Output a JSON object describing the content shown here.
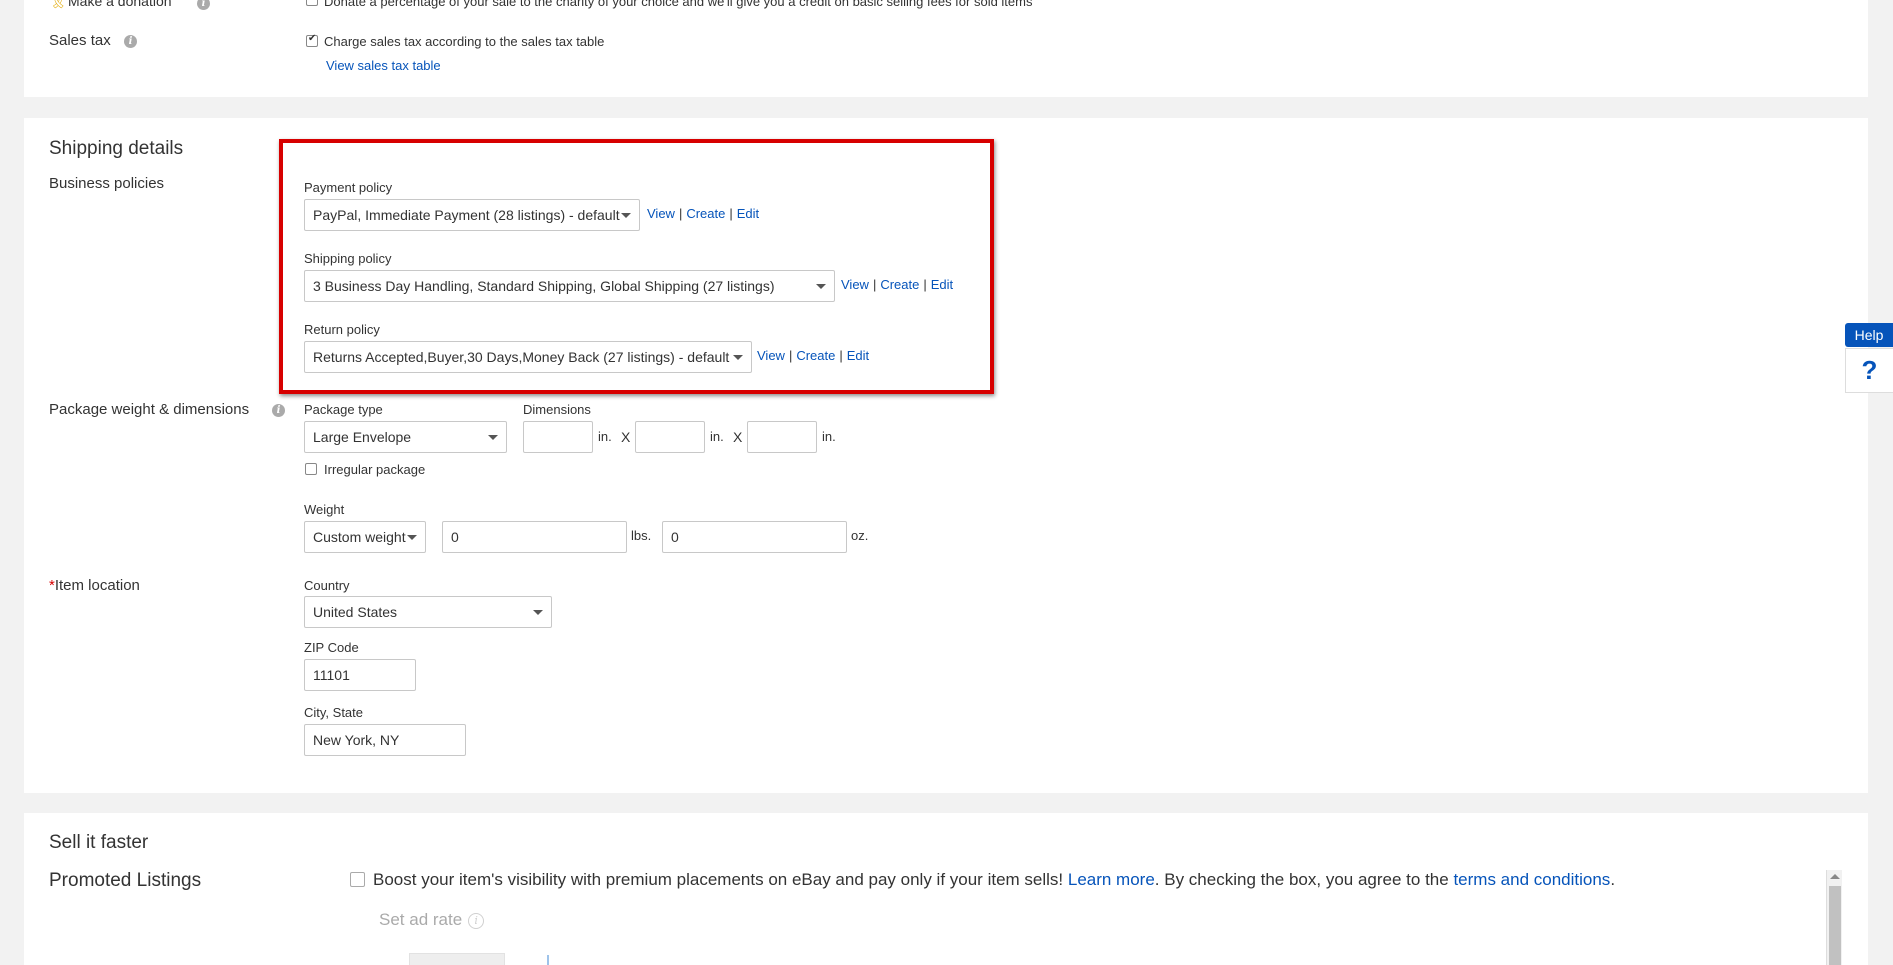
{
  "donation": {
    "label": "Make a donation",
    "checkbox_text": "Donate a percentage of your sale to the charity of your choice and we'll give you a credit on basic selling fees for sold items"
  },
  "sales_tax": {
    "label": "Sales tax",
    "checkbox_text": "Charge sales tax according to the sales tax table",
    "view_table_link": "View sales tax table"
  },
  "shipping": {
    "section_title": "Shipping details",
    "business_policies_label": "Business policies",
    "payment_policy": {
      "label": "Payment policy",
      "value": "PayPal, Immediate Payment (28 listings) - default",
      "view": "View",
      "create": "Create",
      "edit": "Edit",
      "sep": "|"
    },
    "shipping_policy": {
      "label": "Shipping policy",
      "value": "3 Business Day Handling, Standard Shipping, Global Shipping (27 listings)",
      "view": "View",
      "create": "Create",
      "edit": "Edit",
      "sep": "|"
    },
    "return_policy": {
      "label": "Return policy",
      "value": "Returns Accepted,Buyer,30 Days,Money Back (27 listings) - default",
      "view": "View",
      "create": "Create",
      "edit": "Edit",
      "sep": "|"
    },
    "package_label": "Package weight & dimensions",
    "package_type_label": "Package type",
    "package_type_value": "Large Envelope",
    "dimensions_label": "Dimensions",
    "dim_unit": "in.",
    "dim_x": "X",
    "irregular_label": "Irregular package",
    "weight_label": "Weight",
    "weight_type_value": "Custom weight",
    "weight_lbs_value": "0",
    "weight_lbs_unit": "lbs.",
    "weight_oz_value": "0",
    "weight_oz_unit": "oz.",
    "item_location_required": "*",
    "item_location_label": "Item location",
    "country_label": "Country",
    "country_value": "United States",
    "zip_label": "ZIP Code",
    "zip_value": "11101",
    "city_label": "City, State",
    "city_value": "New York, NY"
  },
  "sell_faster": {
    "section_title": "Sell it faster",
    "promoted_label": "Promoted Listings",
    "boost_text_1": "Boost your item's visibility with premium placements on eBay and pay only if your item sells! ",
    "learn_more": "Learn more",
    "boost_text_2": ". By checking the box, you agree to the ",
    "terms_link": "terms and conditions",
    "boost_text_3": ".",
    "ad_rate_label": "Set ad rate"
  },
  "help": {
    "tab_label": "Help",
    "icon_glyph": "?"
  },
  "icons": {
    "info": "i"
  },
  "colors": {
    "link": "#0654ba",
    "highlight_border": "#d70000",
    "required": "#d70000"
  }
}
